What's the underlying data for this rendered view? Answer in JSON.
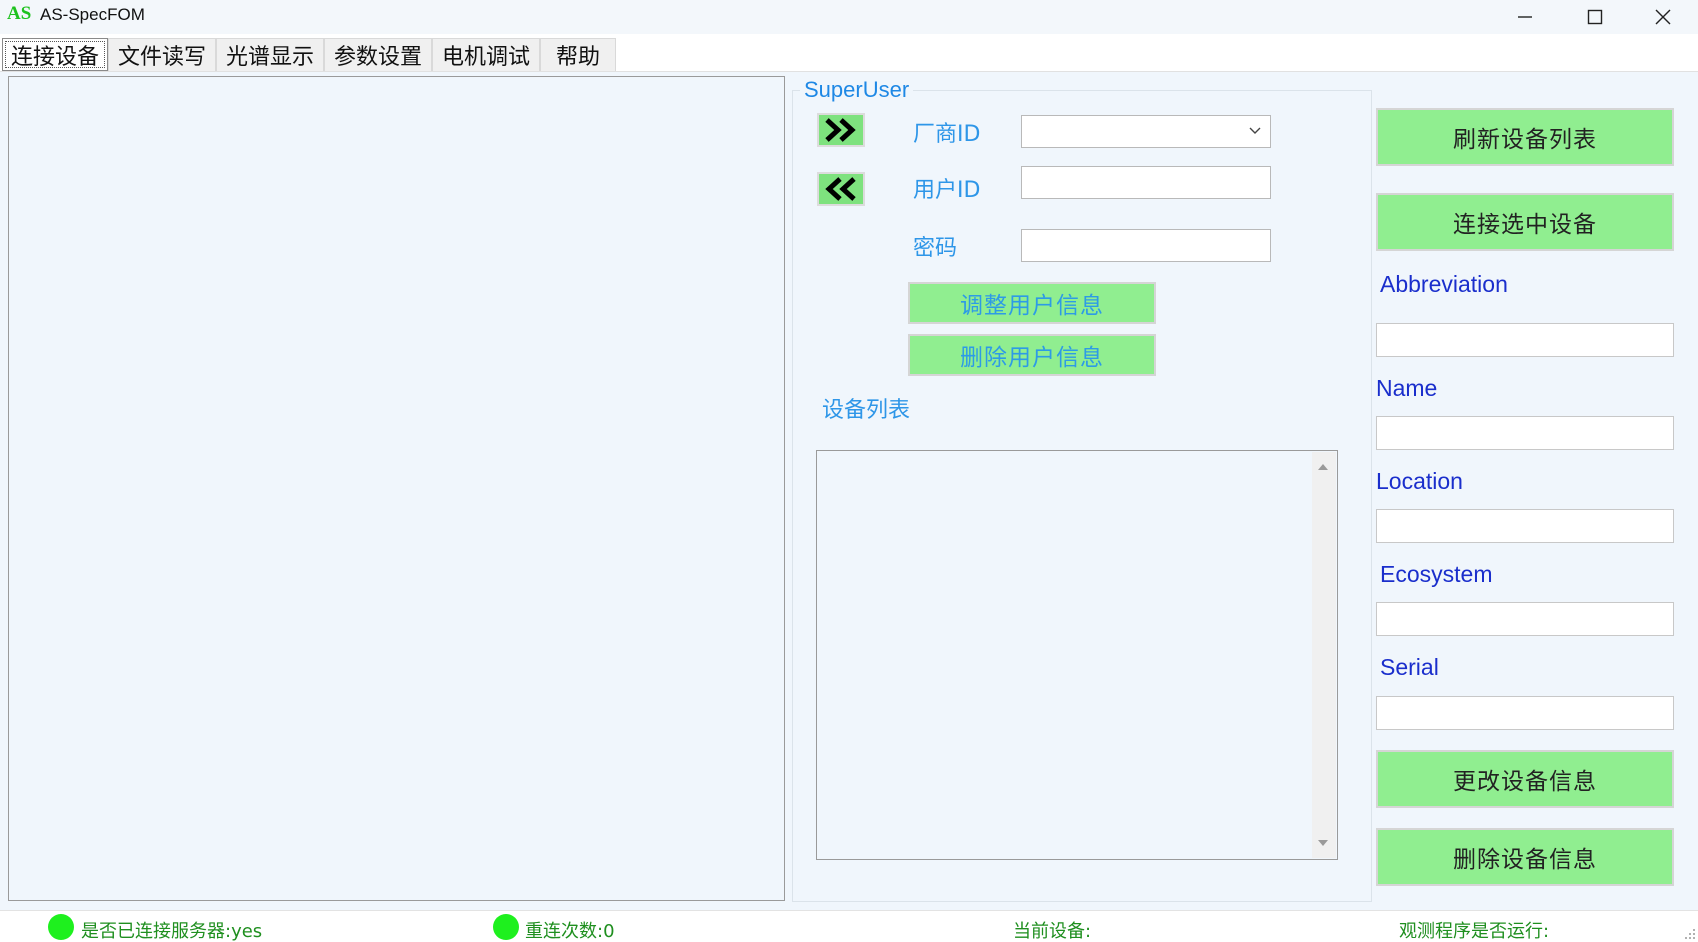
{
  "window": {
    "logo": "AS",
    "title": "AS-SpecFOM"
  },
  "tabs": [
    {
      "label": "连接设备",
      "active": true
    },
    {
      "label": "文件读写",
      "active": false
    },
    {
      "label": "光谱显示",
      "active": false
    },
    {
      "label": "参数设置",
      "active": false
    },
    {
      "label": "电机调试",
      "active": false
    },
    {
      "label": "帮助",
      "active": false
    }
  ],
  "superuser": {
    "title": "SuperUser",
    "vendor_label": "厂商ID",
    "vendor_value": "",
    "user_label": "用户ID",
    "user_value": "",
    "password_label": "密码",
    "password_value": "",
    "adjust_button": "调整用户信息",
    "delete_button": "删除用户信息",
    "device_list_label": "设备列表"
  },
  "device": {
    "refresh_button": "刷新设备列表",
    "connect_button": "连接选中设备",
    "abbreviation_label": "Abbreviation",
    "abbreviation_value": "",
    "name_label": "Name",
    "name_value": "",
    "location_label": "Location",
    "location_value": "",
    "ecosystem_label": "Ecosystem",
    "ecosystem_value": "",
    "serial_label": "Serial",
    "serial_value": "",
    "change_button": "更改设备信息",
    "delete_button": "删除设备信息"
  },
  "status": {
    "server_connected": "是否已连接服务器:yes",
    "reconnect_count": "重连次数:0",
    "current_device": "当前设备:",
    "observer_running": "观测程序是否运行:"
  },
  "colors": {
    "accent_green": "#90ee90",
    "status_green": "#1ef01e",
    "label_blue": "#2e96e8",
    "right_label_blue": "#1a2ecc",
    "panel_bg": "#f0f6fc"
  },
  "icons": {
    "forward": "double-chevron-right-icon",
    "back": "double-chevron-left-icon",
    "minimize": "minimize-icon",
    "maximize": "maximize-icon",
    "close": "close-icon"
  }
}
